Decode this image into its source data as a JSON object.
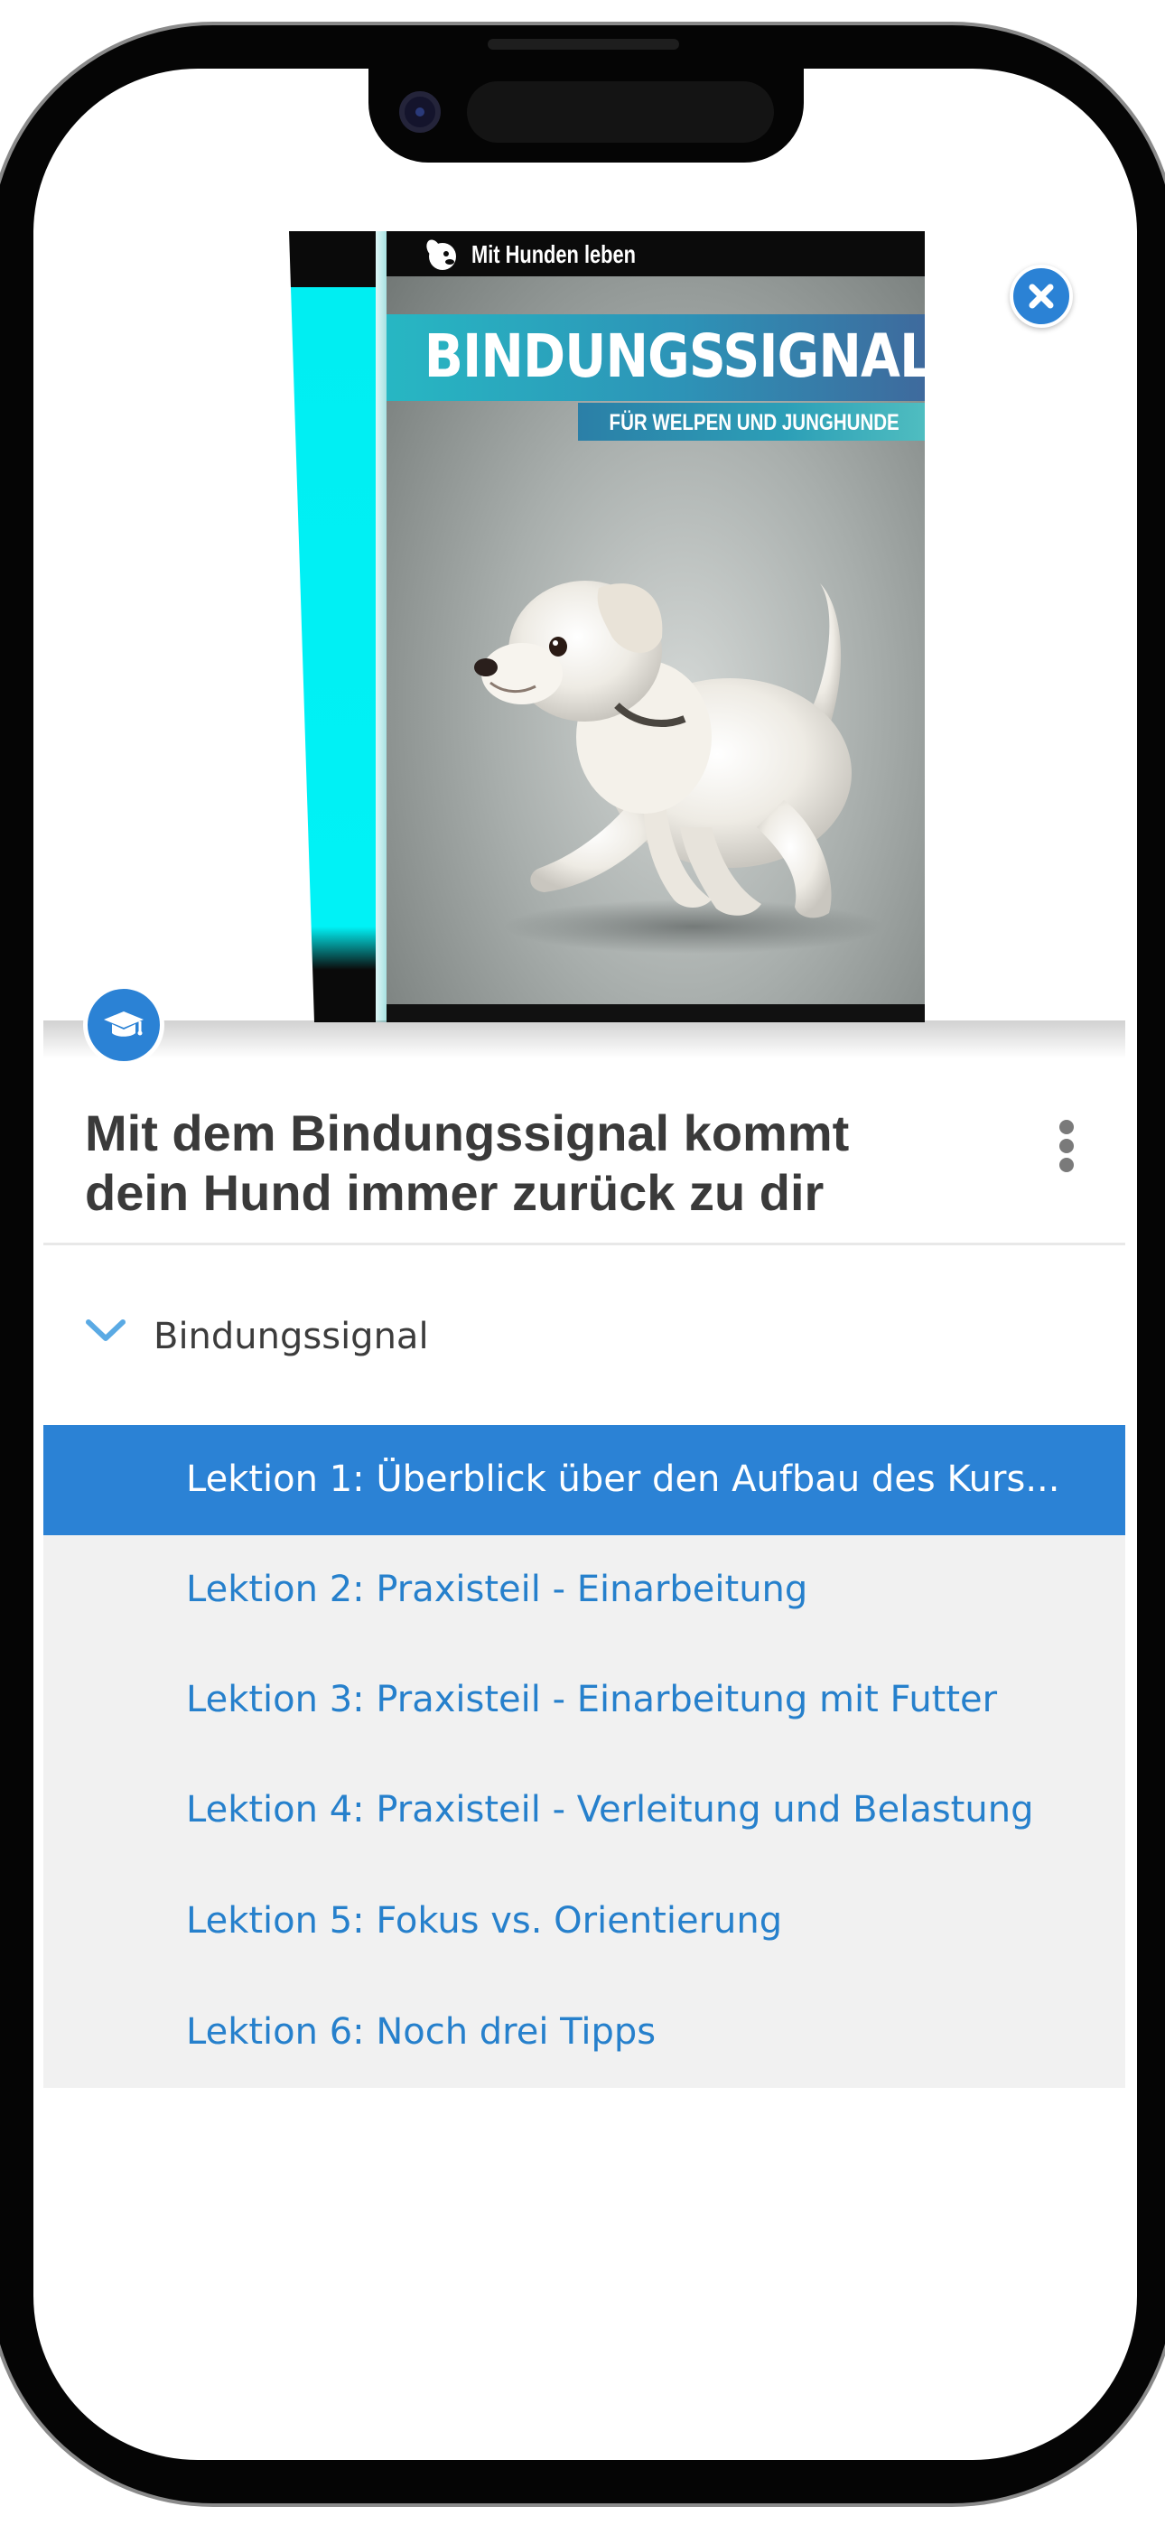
{
  "course": {
    "cover": {
      "brand": "Mit Hunden leben",
      "title": "BINDUNGSSIGNAL",
      "subtitle": "FÜR WELPEN UND JUNGHUNDE"
    },
    "title_line1": "Mit dem Bindungssignal kommt",
    "title_line2": "dein Hund immer zurück zu dir",
    "close_icon": "close-icon",
    "badge_icon": "graduation-cap-icon",
    "menu_icon": "vertical-ellipsis-icon"
  },
  "section": {
    "label": "Bindungssignal",
    "icon": "chevron-down-icon",
    "expanded": true
  },
  "lessons": [
    {
      "label": "Lektion 1: Überblick über den Aufbau des Kurs...",
      "active": true
    },
    {
      "label": "Lektion 2: Praxisteil - Einarbeitung",
      "active": false
    },
    {
      "label": "Lektion 3: Praxisteil - Einarbeitung mit Futter",
      "active": false
    },
    {
      "label": "Lektion 4: Praxisteil - Verleitung und Belastung",
      "active": false
    },
    {
      "label": "Lektion 5: Fokus vs. Orientierung",
      "active": false
    },
    {
      "label": "Lektion 6: Noch drei Tipps",
      "active": false
    }
  ],
  "colors": {
    "accent": "#2b82d5",
    "lesson_text": "#2680cc",
    "list_background": "#f1f1f1",
    "title_text": "#3a3a3a"
  }
}
